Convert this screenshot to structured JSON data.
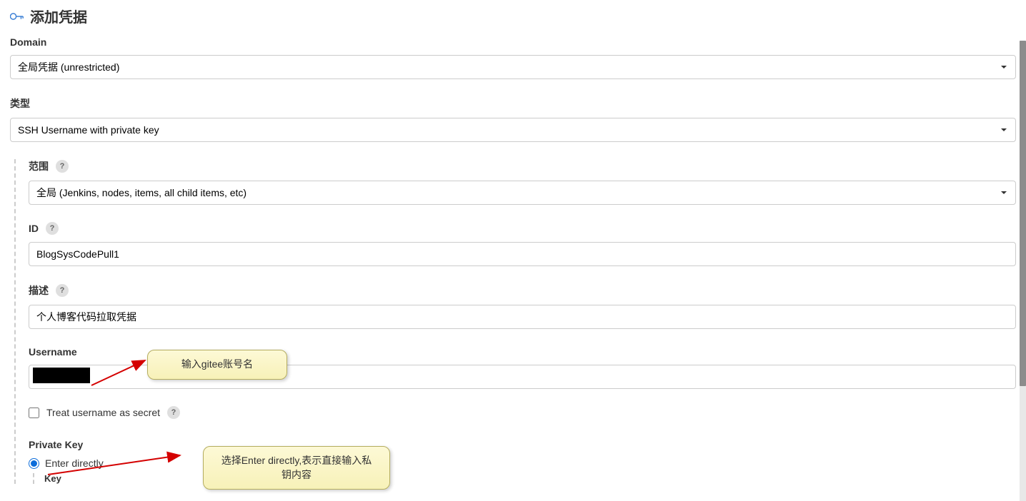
{
  "header": {
    "title": "添加凭据"
  },
  "fields": {
    "domain": {
      "label": "Domain",
      "value": "全局凭据 (unrestricted)"
    },
    "type": {
      "label": "类型",
      "value": "SSH Username with private key"
    },
    "scope": {
      "label": "范围",
      "value": "全局 (Jenkins, nodes, items, all child items, etc)"
    },
    "id": {
      "label": "ID",
      "value": "BlogSysCodePull1"
    },
    "description": {
      "label": "描述",
      "value": "个人博客代码拉取凭据"
    },
    "username": {
      "label": "Username",
      "value": ""
    },
    "treatSecret": {
      "label": "Treat username as secret",
      "checked": false
    },
    "privateKey": {
      "label": "Private Key",
      "radioOption": "Enter directly",
      "radioChecked": true,
      "keyLabel": "Key"
    }
  },
  "helpGlyph": "?",
  "annotations": {
    "usernameTip": "输入gitee账号名",
    "privateKeyTip": "选择Enter directly,表示直接输入私钥内容"
  }
}
